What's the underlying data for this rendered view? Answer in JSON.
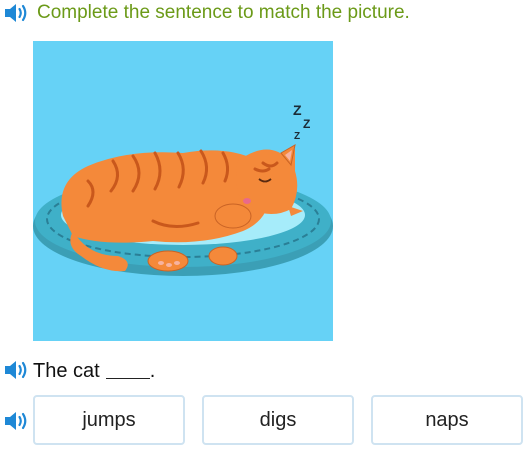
{
  "instruction": {
    "text": "Complete the sentence to match the picture."
  },
  "sentence": {
    "prefix": "The cat",
    "suffix": "."
  },
  "choices": [
    {
      "label": "jumps"
    },
    {
      "label": "digs"
    },
    {
      "label": "naps"
    }
  ],
  "picture": {
    "sleep_letters": [
      "Z",
      "Z",
      "Z"
    ]
  },
  "colors": {
    "instruction": "#6b9a18",
    "speaker": "#1e88d6",
    "picture_bg": "#66d2f6",
    "choice_border": "#cfe3f1"
  }
}
